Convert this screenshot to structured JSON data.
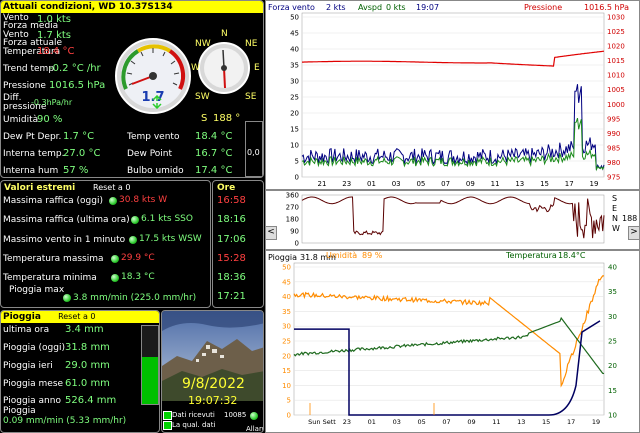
{
  "current": {
    "title": "Attuali condizioni, WD 10.37S134",
    "rows": [
      {
        "label": "Vento",
        "label2": "Forza media",
        "value": "1.0 kts"
      },
      {
        "label": "Vento",
        "label2": "Forza attuale",
        "value": "1.7 kts"
      },
      {
        "label": "Temperatura",
        "value": "18.4 °C"
      },
      {
        "label": "Trend temp",
        "value": "-0.2 °C /hr"
      },
      {
        "label": "Pressione",
        "value": "1016.5 hPa"
      },
      {
        "label": "Diff.",
        "label2": "pressione",
        "value": "-0.3hPa/hr"
      },
      {
        "label": "Umidità",
        "value": "90 %"
      },
      {
        "label": "Dew Pt Depr.",
        "value": "1.7 °C"
      },
      {
        "label": "Interna temp.",
        "value": "27.0 °C"
      },
      {
        "label": "Interna hum",
        "value": "57 %"
      }
    ],
    "right_rows": [
      {
        "label": "Temp vento",
        "value": "18.4 °C"
      },
      {
        "label": "Dew Point",
        "value": "16.7 °C"
      },
      {
        "label": "Bulbo umido",
        "value": "17.4 °C"
      }
    ],
    "gauge_value": "1.7",
    "compass": {
      "n": "N",
      "ne": "NE",
      "nw": "NW",
      "sw": "SW",
      "se": "SE",
      "w": "W",
      "e": "E"
    },
    "wind_dir": "S",
    "wind_deg": "188 °",
    "side_value": "0,0",
    "colors": {
      "header": "#ffff00",
      "value": "#7fff7f",
      "alert": "#ff4040"
    }
  },
  "extremes": {
    "title": "Valori estremi",
    "reset": "Reset a 0",
    "time_title": "Ore",
    "rows": [
      {
        "label": "Massima raffica (oggi)",
        "value": "30.8 kts  W",
        "time": "16:58",
        "alert": true
      },
      {
        "label": "Massima raffica (ultima ora)",
        "value": "6.1 kts SSO",
        "time": "18:16",
        "alert": false
      },
      {
        "label": "Massimo vento in 1 minuto",
        "value": "17.5 kts WSW",
        "time": "17:06",
        "alert": false
      },
      {
        "label": "Temperatura massima",
        "value": "29.9 °C",
        "time": "15:28",
        "alert": true
      },
      {
        "label": "Temperatura minima",
        "value": "18.3 °C",
        "time": "18:36",
        "alert": false
      },
      {
        "label": "Pioggia max",
        "value": "3.8 mm/min (225.0 mm/hr)",
        "time": "17:21",
        "alert": false
      }
    ]
  },
  "rain": {
    "title": "Pioggia",
    "reset": "Reset a 0",
    "rows": [
      {
        "label": "ultima ora",
        "value": "3.4 mm"
      },
      {
        "label": "Pioggia (oggi)",
        "value": "31.8 mm"
      },
      {
        "label": "Pioggia ieri",
        "value": "29.0 mm"
      },
      {
        "label": "Pioggia mese",
        "value": "61.0 mm"
      },
      {
        "label": "Pioggia anno",
        "value": "526.4 mm"
      }
    ],
    "rate_label": "Pioggia",
    "rate_value": "0.09 mm/min (5.33 mm/hr)",
    "bar_fill": 0.6
  },
  "photo": {
    "date": "9/8/2022",
    "time": "19:07:32",
    "data_received_label": "Dati ricevuti",
    "data_received_count": "10085",
    "data_quality_label": "La qual. dati",
    "alarm_label": "Allarm"
  },
  "wind_chart": {
    "legend": {
      "wind_label": "Forza vento",
      "wind_unit": "2 kts",
      "avg_label": "Avspd",
      "avg_unit": "0 kts",
      "time": "19:07",
      "pressure_label": "Pressione",
      "pressure_value": "1016.5 hPa"
    },
    "y_left": [
      "0",
      "5",
      "10",
      "15",
      "20",
      "25",
      "30",
      "35",
      "40",
      "45",
      "50"
    ],
    "y_right": [
      "975",
      "980",
      "985",
      "990",
      "995",
      "1000",
      "1005",
      "1010",
      "1015",
      "1020",
      "1025",
      "1030"
    ],
    "x_ticks": [
      "21",
      "23",
      "01",
      "03",
      "05",
      "07",
      "09",
      "11",
      "13",
      "15",
      "17",
      "19"
    ]
  },
  "dir_chart": {
    "y_ticks": [
      "0",
      "90",
      "180",
      "270",
      "360"
    ],
    "side_letters": [
      "S",
      "E",
      "N",
      "W"
    ],
    "side_value": "188",
    "nav_left": "<",
    "nav_right": ">"
  },
  "rain_chart": {
    "legend": {
      "rain_label": "Pioggia",
      "rain_value": "31.8 mm",
      "hum_label": "Umidità",
      "hum_value": "89 %",
      "temp_label": "Temperatura",
      "temp_value": "18.4°C"
    },
    "y_left": [
      "0",
      "5",
      "10",
      "15",
      "20",
      "25",
      "30",
      "35",
      "40",
      "45",
      "50"
    ],
    "y_right": [
      "10",
      "15",
      "20",
      "25",
      "30",
      "35",
      "40"
    ],
    "x_ticks": [
      "Sun Sett",
      "23",
      "01",
      "03",
      "05",
      "07",
      "09",
      "11",
      "13",
      "15",
      "17",
      "19"
    ]
  }
}
